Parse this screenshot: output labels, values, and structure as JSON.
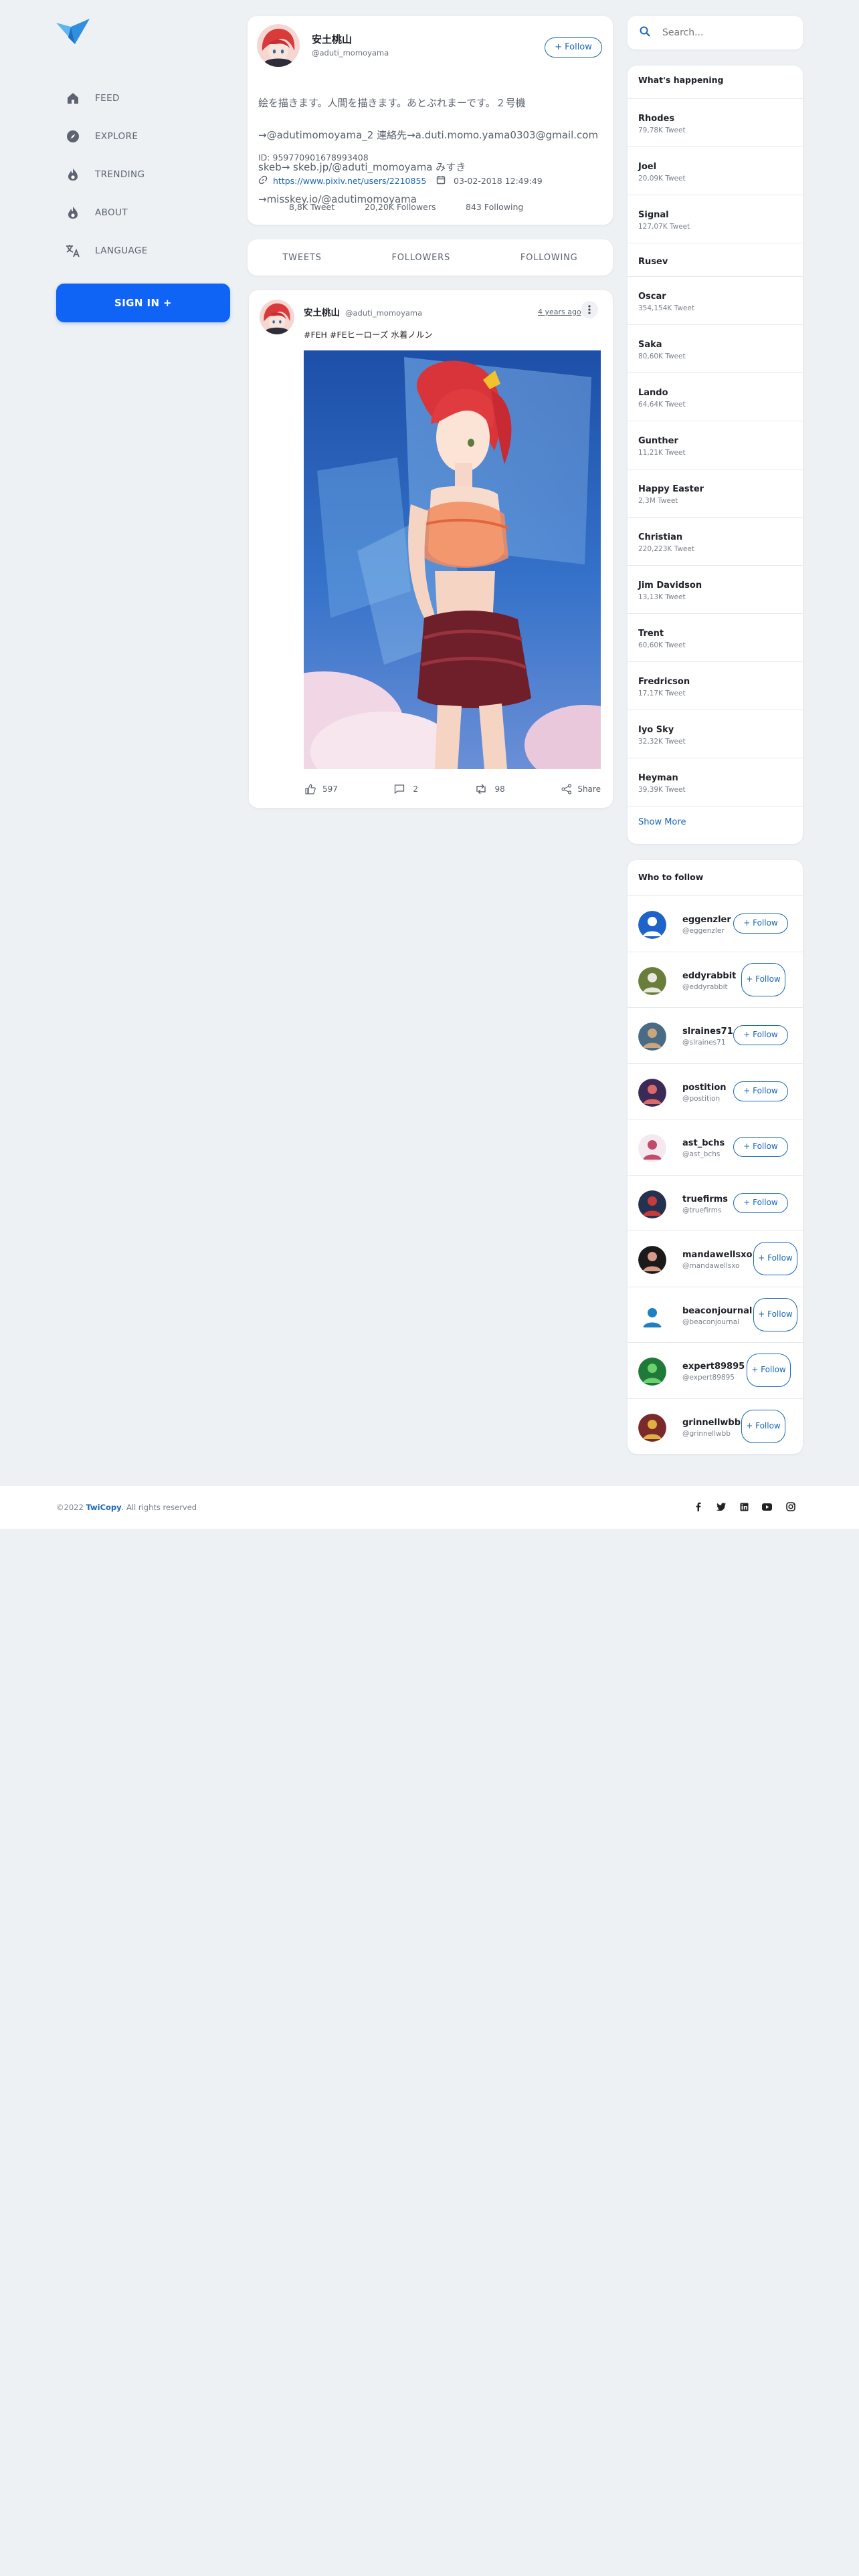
{
  "nav": {
    "items": [
      {
        "label": "FEED",
        "icon": "home-icon"
      },
      {
        "label": "EXPLORE",
        "icon": "compass-icon"
      },
      {
        "label": "TRENDING",
        "icon": "flame-icon"
      },
      {
        "label": "ABOUT",
        "icon": "flame-icon"
      },
      {
        "label": "LANGUAGE",
        "icon": "translate-icon"
      }
    ],
    "signin_label": "SIGN IN +"
  },
  "profile": {
    "name": "安土桃山",
    "handle": "@aduti_momoyama",
    "follow_label": "+ Follow",
    "bio_lines": [
      "絵を描きます。人間を描きます。あとぶれまーです。２号機",
      "→@adutimomoyama_2 連絡先→a.duti.momo.yama0303@gmail.com",
      "skeb→ skeb.jp/@aduti_momoyama みすき",
      "→misskey.io/@adutimomoyama"
    ],
    "id_label": "ID:",
    "id_value": "959770901678993408",
    "url": "https://www.pixiv.net/users/2210855",
    "joined": "03-02-2018 12:49:49",
    "tweets": "8,8K Tweet",
    "followers": "20,20K Followers",
    "following": "843 Following"
  },
  "tabs": [
    "TWEETS",
    "FOLLOWERS",
    "FOLLOWING"
  ],
  "tweet": {
    "name": "安土桃山",
    "handle": "@aduti_momoyama",
    "time": "4 years ago",
    "text": "#FEH #FEヒーローズ 水着ノルン",
    "likes": "597",
    "replies": "2",
    "retweets": "98",
    "share_label": "Share"
  },
  "search": {
    "placeholder": "Search..."
  },
  "trends": {
    "title": "What's happening",
    "items": [
      {
        "name": "Rhodes",
        "count": "79,78K Tweet"
      },
      {
        "name": "Joel",
        "count": "20,09K Tweet"
      },
      {
        "name": "Signal",
        "count": "127,07K Tweet"
      },
      {
        "name": "Rusev",
        "count": ""
      },
      {
        "name": "Oscar",
        "count": "354,154K Tweet"
      },
      {
        "name": "Saka",
        "count": "80,60K Tweet"
      },
      {
        "name": "Lando",
        "count": "64,64K Tweet"
      },
      {
        "name": "Gunther",
        "count": "11,21K Tweet"
      },
      {
        "name": "Happy Easter",
        "count": "2,3M Tweet"
      },
      {
        "name": "Christian",
        "count": "220,223K Tweet"
      },
      {
        "name": "Jim Davidson",
        "count": "13,13K Tweet"
      },
      {
        "name": "Trent",
        "count": "60,60K Tweet"
      },
      {
        "name": "Fredricson",
        "count": "17,17K Tweet"
      },
      {
        "name": "Iyo Sky",
        "count": "32,32K Tweet"
      },
      {
        "name": "Heyman",
        "count": "39,39K Tweet"
      }
    ],
    "show_more": "Show More"
  },
  "who": {
    "title": "Who to follow",
    "items": [
      {
        "name": "eggenzler",
        "handle": "@eggenzler",
        "follow": "+ Follow"
      },
      {
        "name": "eddyrabbit",
        "handle": "@eddyrabbit",
        "follow": "+ Follow"
      },
      {
        "name": "slraines71",
        "handle": "@slraines71",
        "follow": "+ Follow"
      },
      {
        "name": "postition",
        "handle": "@postition",
        "follow": "+ Follow"
      },
      {
        "name": "ast_bchs",
        "handle": "@ast_bchs",
        "follow": "+ Follow"
      },
      {
        "name": "truefirms",
        "handle": "@truefirms",
        "follow": "+ Follow"
      },
      {
        "name": "mandawellsxo",
        "handle": "@mandawellsxo",
        "follow": "+ Follow"
      },
      {
        "name": "beaconjournal",
        "handle": "@beaconjournal",
        "follow": "+ Follow"
      },
      {
        "name": "expert89895",
        "handle": "@expert89895",
        "follow": "+ Follow"
      },
      {
        "name": "grinnellwbb",
        "handle": "@grinnellwbb",
        "follow": "+ Follow"
      }
    ]
  },
  "footer": {
    "year": "©2022",
    "brand": "TwiCopy",
    "rights": ". All rights reserved",
    "social": [
      "facebook-icon",
      "twitter-icon",
      "linkedin-icon",
      "youtube-icon",
      "instagram-icon"
    ]
  },
  "colors": {
    "accent": "#0f64f6",
    "link": "#1a66b5",
    "background": "#edf1f4"
  }
}
